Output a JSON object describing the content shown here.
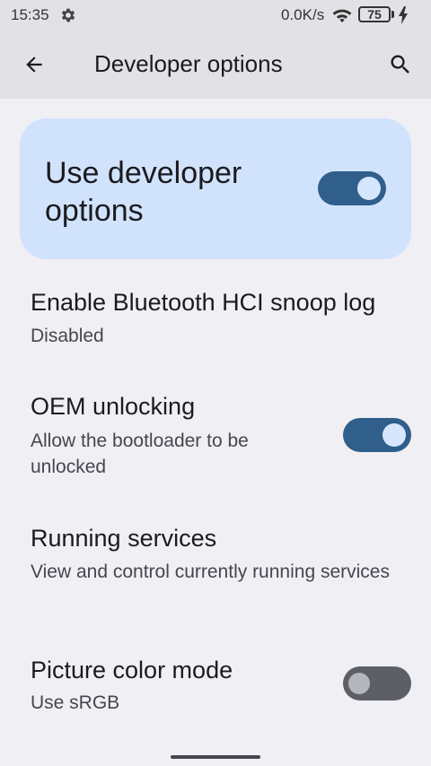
{
  "status_bar": {
    "time": "15:35",
    "network_speed": "0.0K/s",
    "battery_level": "75",
    "icons": [
      "settings-gear-icon",
      "wifi-icon",
      "battery-icon",
      "charging-bolt-icon"
    ]
  },
  "app_bar": {
    "title": "Developer options",
    "back_icon": "arrow-back-icon",
    "search_icon": "search-icon"
  },
  "master_switch": {
    "label": "Use developer options",
    "checked": true
  },
  "preferences": [
    {
      "title": "Enable Bluetooth HCI snoop log",
      "summary": "Disabled"
    },
    {
      "title": "OEM unlocking",
      "summary": "Allow the bootloader to be unlocked",
      "switch": true,
      "checked": true
    },
    {
      "title": "Running services",
      "summary": "View and control currently running services"
    },
    {
      "title": "Picture color mode",
      "summary": "Use sRGB",
      "switch": true,
      "checked": false
    }
  ],
  "colors": {
    "background": "#f0eff4",
    "app_bar": "#e2e2e6",
    "master_card": "#d1e3fc",
    "switch_on_track": "#2f5f8a",
    "switch_off_track": "#5d5f66"
  }
}
